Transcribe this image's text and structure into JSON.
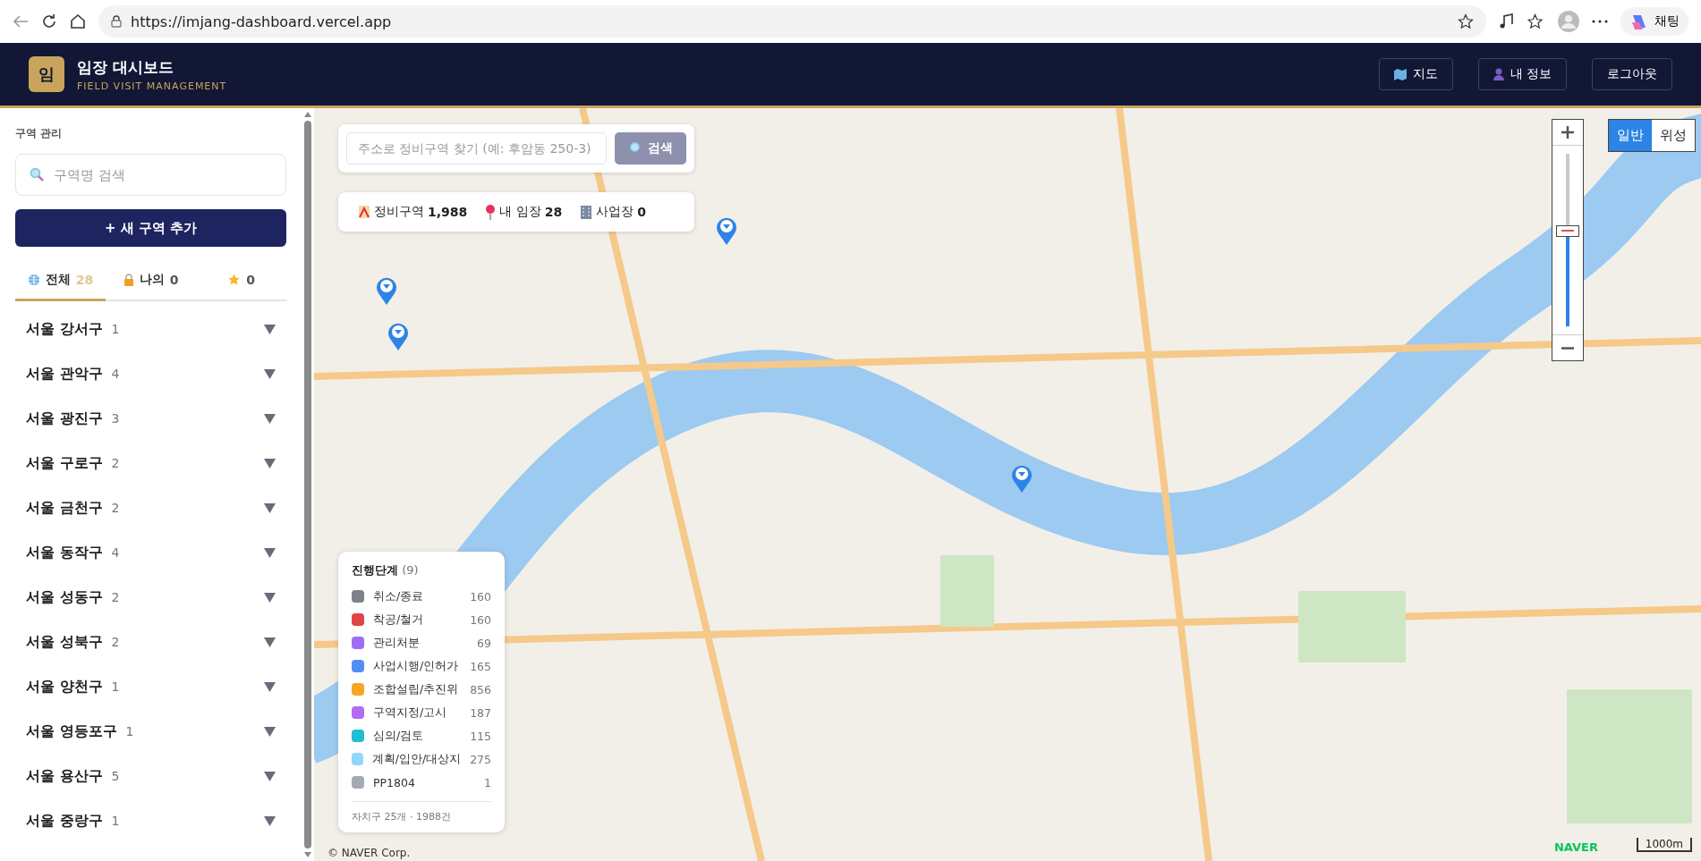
{
  "browser": {
    "url": "https://imjang-dashboard.vercel.app",
    "chat_label": "채팅"
  },
  "header": {
    "logo_letter": "임",
    "title": "임장 대시보드",
    "subtitle": "FIELD VISIT MANAGEMENT",
    "buttons": [
      {
        "kind": "map",
        "label": "지도"
      },
      {
        "kind": "profile",
        "label": "내 정보"
      },
      {
        "kind": "logout",
        "label": "로그아웃"
      }
    ]
  },
  "sidebar": {
    "section_title": "구역 관리",
    "search": {
      "placeholder": "구역명 검색"
    },
    "add_button": "+ 새 구역 추가",
    "tabs": [
      {
        "kind": "all",
        "label": "전체",
        "count": "28",
        "selected": true
      },
      {
        "kind": "mine",
        "label": "나의",
        "count": "0",
        "selected": false
      },
      {
        "kind": "starred",
        "count": "0",
        "selected": false
      }
    ],
    "districts": [
      {
        "name": "서울 강서구",
        "count": "1"
      },
      {
        "name": "서울 관악구",
        "count": "4"
      },
      {
        "name": "서울 광진구",
        "count": "3"
      },
      {
        "name": "서울 구로구",
        "count": "2"
      },
      {
        "name": "서울 금천구",
        "count": "2"
      },
      {
        "name": "서울 동작구",
        "count": "4"
      },
      {
        "name": "서울 성동구",
        "count": "2"
      },
      {
        "name": "서울 성북구",
        "count": "2"
      },
      {
        "name": "서울 양천구",
        "count": "1"
      },
      {
        "name": "서울 영등포구",
        "count": "1"
      },
      {
        "name": "서울 용산구",
        "count": "5"
      },
      {
        "name": "서울 중랑구",
        "count": "1"
      }
    ]
  },
  "map": {
    "address_search": {
      "placeholder": "주소로 정비구역 찾기 (예: 후암동 250-3)",
      "button": "검색"
    },
    "stats": [
      {
        "kind": "zone",
        "label": "정비구역",
        "value": "1,988"
      },
      {
        "kind": "pin",
        "label": "내 임장",
        "value": "28"
      },
      {
        "kind": "site",
        "label": "사업장",
        "value": "0"
      }
    ],
    "legend": {
      "title": "진행단계",
      "count": "(9)",
      "items": [
        {
          "label": "취소/종료",
          "count": "160",
          "color": "#7c818c"
        },
        {
          "label": "착공/철거",
          "count": "160",
          "color": "#e04444"
        },
        {
          "label": "관리처분",
          "count": "69",
          "color": "#9d6ef5"
        },
        {
          "label": "사업시행/인허가",
          "count": "165",
          "color": "#4f8ef5"
        },
        {
          "label": "조합설립/추진위",
          "count": "856",
          "color": "#f5a623"
        },
        {
          "label": "구역지정/고시",
          "count": "187",
          "color": "#b06cf2"
        },
        {
          "label": "심의/검토",
          "count": "115",
          "color": "#22bcd3"
        },
        {
          "label": "계획/입안/대상지",
          "count": "275",
          "color": "#8fd8fa"
        },
        {
          "label": "PP1804",
          "count": "1",
          "color": "#a4a9b2"
        }
      ],
      "footer": "자치구 25개 · 1988건"
    },
    "map_types": [
      {
        "label": "일반",
        "selected": true
      },
      {
        "label": "위성",
        "selected": false
      }
    ],
    "zoom": {
      "level": 0.55
    },
    "attribution": "© NAVER Corp.",
    "logo": "NAVER",
    "scale": "1000m"
  }
}
